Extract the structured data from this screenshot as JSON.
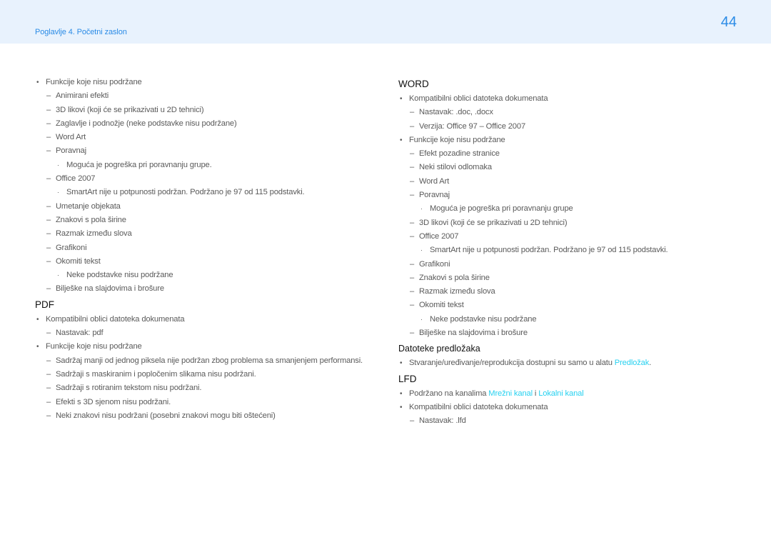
{
  "header": {
    "chapter": "Poglavlje 4. Početni zaslon",
    "page_number": "44",
    "accent_color": "#2a8be6"
  },
  "left_column": {
    "intro": [
      {
        "level": 0,
        "text": "Funkcije koje nisu podržane"
      },
      {
        "level": 1,
        "text": "Animirani efekti"
      },
      {
        "level": 1,
        "text": "3D likovi (koji će se prikazivati u 2D tehnici)"
      },
      {
        "level": 1,
        "text": "Zaglavlje i podnožje (neke podstavke nisu podržane)"
      },
      {
        "level": 1,
        "text": "Word Art"
      },
      {
        "level": 1,
        "text": "Poravnaj"
      },
      {
        "level": 2,
        "text": "Moguća je pogreška pri poravnanju grupe."
      },
      {
        "level": 1,
        "text": "Office 2007"
      },
      {
        "level": 2,
        "text": "SmartArt nije u potpunosti podržan. Podržano je 97 od 115 podstavki."
      },
      {
        "level": 1,
        "text": "Umetanje objekata"
      },
      {
        "level": 1,
        "text": "Znakovi s pola širine"
      },
      {
        "level": 1,
        "text": "Razmak između slova"
      },
      {
        "level": 1,
        "text": "Grafikoni"
      },
      {
        "level": 1,
        "text": "Okomiti tekst"
      },
      {
        "level": 2,
        "text": "Neke podstavke nisu podržane"
      },
      {
        "level": 1,
        "text": "Bilješke na slajdovima i brošure"
      }
    ],
    "pdf": {
      "title": "PDF",
      "items": [
        {
          "level": 0,
          "text": "Kompatibilni oblici datoteka dokumenata"
        },
        {
          "level": 1,
          "text": "Nastavak: pdf"
        },
        {
          "level": 0,
          "text": "Funkcije koje nisu podržane"
        },
        {
          "level": 1,
          "text": "Sadržaj manji od jednog piksela nije podržan zbog problema sa smanjenjem performansi."
        },
        {
          "level": 1,
          "text": "Sadržaji s maskiranim i popločenim slikama nisu podržani."
        },
        {
          "level": 1,
          "text": "Sadržaji s rotiranim tekstom nisu podržani."
        },
        {
          "level": 1,
          "text": "Efekti s 3D sjenom nisu podržani."
        },
        {
          "level": 1,
          "text": "Neki znakovi nisu podržani (posebni znakovi mogu biti oštećeni)"
        }
      ]
    }
  },
  "right_column": {
    "word": {
      "title": "WORD",
      "items": [
        {
          "level": 0,
          "text": "Kompatibilni oblici datoteka dokumenata"
        },
        {
          "level": 1,
          "text": "Nastavak: .doc, .docx"
        },
        {
          "level": 1,
          "text": "Verzija: Office 97 – Office 2007"
        },
        {
          "level": 0,
          "text": "Funkcije koje nisu podržane"
        },
        {
          "level": 1,
          "text": "Efekt pozadine stranice"
        },
        {
          "level": 1,
          "text": "Neki stilovi odlomaka"
        },
        {
          "level": 1,
          "text": "Word Art"
        },
        {
          "level": 1,
          "text": "Poravnaj"
        },
        {
          "level": 2,
          "text": "Moguća je pogreška pri poravnanju grupe"
        },
        {
          "level": 1,
          "text": "3D likovi (koji će se prikazivati u 2D tehnici)"
        },
        {
          "level": 1,
          "text": "Office 2007"
        },
        {
          "level": 2,
          "text": "SmartArt nije u potpunosti podržan. Podržano je 97 od 115 podstavki."
        },
        {
          "level": 1,
          "text": "Grafikoni"
        },
        {
          "level": 1,
          "text": "Znakovi s pola širine"
        },
        {
          "level": 1,
          "text": "Razmak između slova"
        },
        {
          "level": 1,
          "text": "Okomiti tekst"
        },
        {
          "level": 2,
          "text": "Neke podstavke nisu podržane"
        },
        {
          "level": 1,
          "text": "Bilješke na slajdovima i brošure"
        }
      ]
    },
    "templates": {
      "title": "Datoteke predložaka",
      "item_text": "Stvaranje/uređivanje/reprodukcija dostupni su samo u alatu ",
      "item_link": "Predložak",
      "item_end": "."
    },
    "lfd": {
      "title": "LFD",
      "supported_prefix": "Podržano na kanalima ",
      "link_network": "Mrežni kanal",
      "conjunction": " i ",
      "link_local": "Lokalni kanal",
      "items": [
        {
          "level": 0,
          "text": "Kompatibilni oblici datoteka dokumenata"
        },
        {
          "level": 1,
          "text": "Nastavak: .lfd"
        }
      ]
    },
    "link_color": "#27d1f0"
  },
  "markers": {
    "0": "•",
    "1": "–",
    "2": "·"
  }
}
